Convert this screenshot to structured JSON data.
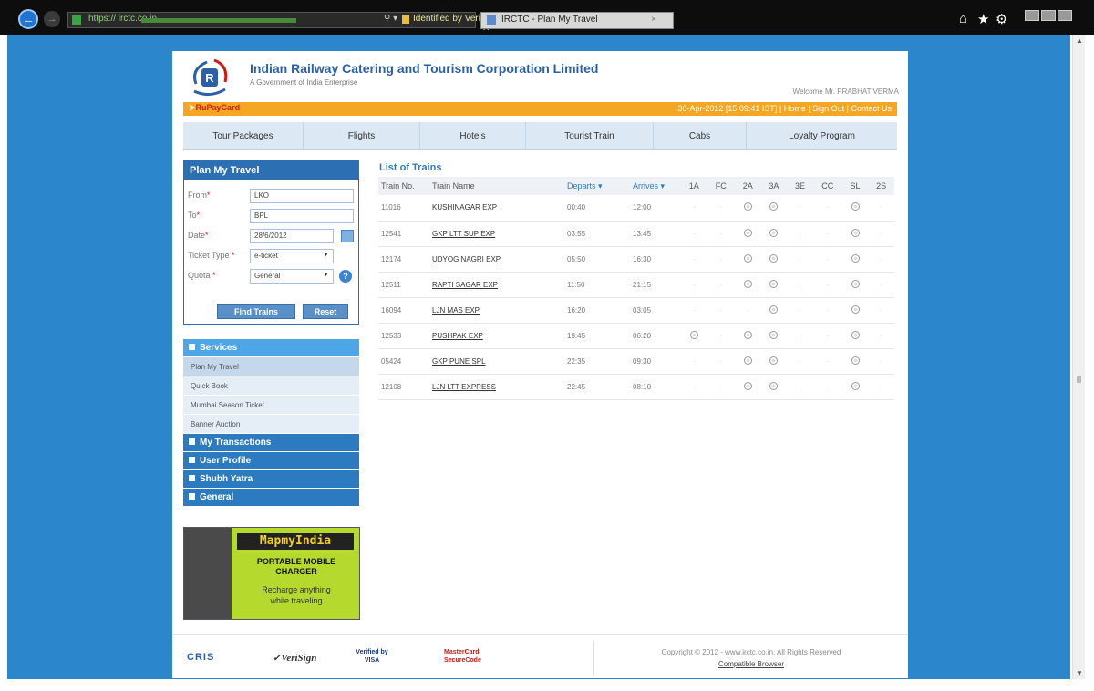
{
  "browser": {
    "url": "https://",
    "url_domain": "irctc.co.in",
    "identity": "Identified by Veri...",
    "tab_title": "IRCTC - Plan My Travel",
    "tab_close": "×"
  },
  "header": {
    "title": "Indian Railway Catering and Tourism Corporation Limited",
    "subtitle": "A Government of India Enterprise",
    "welcome": "Welcome Mr. PRABHAT VERMA"
  },
  "topbar": {
    "rupay": "RuPayCard",
    "info": "30-Apr-2012 [15:09:41 IST]  |  Home  |  Sign Out  |  Contact Us"
  },
  "menu": [
    "Tour Packages",
    "Flights",
    "Hotels",
    "Tourist Train",
    "Cabs",
    "Loyalty Program"
  ],
  "plan": {
    "title": "Plan My Travel",
    "from_label": "From",
    "from_value": "LKO",
    "to_label": "To",
    "to_value": "BPL",
    "date_label": "Date",
    "date_value": "28/6/2012",
    "ticket_label": "Ticket Type",
    "ticket_value": "e-ticket",
    "quota_label": "Quota",
    "quota_value": "General",
    "find_button": "Find Trains",
    "reset_button": "Reset"
  },
  "services": {
    "title": "Services",
    "items": [
      "Plan My Travel",
      "Quick Book",
      "Mumbai Season Ticket",
      "Banner Auction"
    ]
  },
  "sections": [
    "My Transactions",
    "User Profile",
    "Shubh Yatra",
    "General"
  ],
  "ad": {
    "brand": "MapmyIndia",
    "line1": "PORTABLE MOBILE",
    "line2": "CHARGER",
    "line3": "Recharge anything",
    "line4": "while traveling"
  },
  "trains": {
    "title": "List of Trains",
    "columns": [
      "Train No.",
      "Train Name",
      "Departs",
      "Arrives",
      "1A",
      "FC",
      "2A",
      "3A",
      "3E",
      "CC",
      "SL",
      "2S"
    ],
    "rows": [
      {
        "no": "11016",
        "name": "KUSHINAGAR EXP",
        "dep": "00:40",
        "arr": "12:00",
        "classes": [
          0,
          0,
          1,
          1,
          0,
          0,
          1,
          0
        ]
      },
      {
        "no": "12541",
        "name": "GKP LTT SUP EXP",
        "dep": "03:55",
        "arr": "13:45",
        "classes": [
          0,
          0,
          1,
          1,
          0,
          0,
          1,
          0
        ]
      },
      {
        "no": "12174",
        "name": "UDYOG NAGRI EXP",
        "dep": "05:50",
        "arr": "16:30",
        "classes": [
          0,
          0,
          1,
          1,
          0,
          0,
          1,
          0
        ]
      },
      {
        "no": "12511",
        "name": "RAPTI SAGAR EXP",
        "dep": "11:50",
        "arr": "21:15",
        "classes": [
          0,
          0,
          1,
          1,
          0,
          0,
          1,
          0
        ]
      },
      {
        "no": "16094",
        "name": "LJN MAS EXP",
        "dep": "16:20",
        "arr": "03:05",
        "classes": [
          0,
          0,
          0,
          1,
          0,
          0,
          1,
          0
        ]
      },
      {
        "no": "12533",
        "name": "PUSHPAK EXP",
        "dep": "19:45",
        "arr": "06:20",
        "classes": [
          1,
          0,
          1,
          1,
          0,
          0,
          1,
          0
        ]
      },
      {
        "no": "05424",
        "name": "GKP PUNE SPL",
        "dep": "22:35",
        "arr": "09:30",
        "classes": [
          0,
          0,
          1,
          1,
          0,
          0,
          1,
          0
        ]
      },
      {
        "no": "12108",
        "name": "LJN LTT EXPRESS",
        "dep": "22:45",
        "arr": "08:10",
        "classes": [
          0,
          0,
          1,
          1,
          0,
          0,
          1,
          0
        ]
      }
    ]
  },
  "footer": {
    "cris": "CRIS",
    "verisign": "VeriSign",
    "verified": "Verified by VISA",
    "mastercard": "MasterCard SecureCode",
    "copyright": "Copyright © 2012 - www.irctc.co.in. All Rights Reserved",
    "compatible": "Compatible Browser"
  },
  "colors": {
    "page_bg": "#2c86cb",
    "brand_blue": "#2a60a8",
    "accent_orange": "#f5a623"
  }
}
